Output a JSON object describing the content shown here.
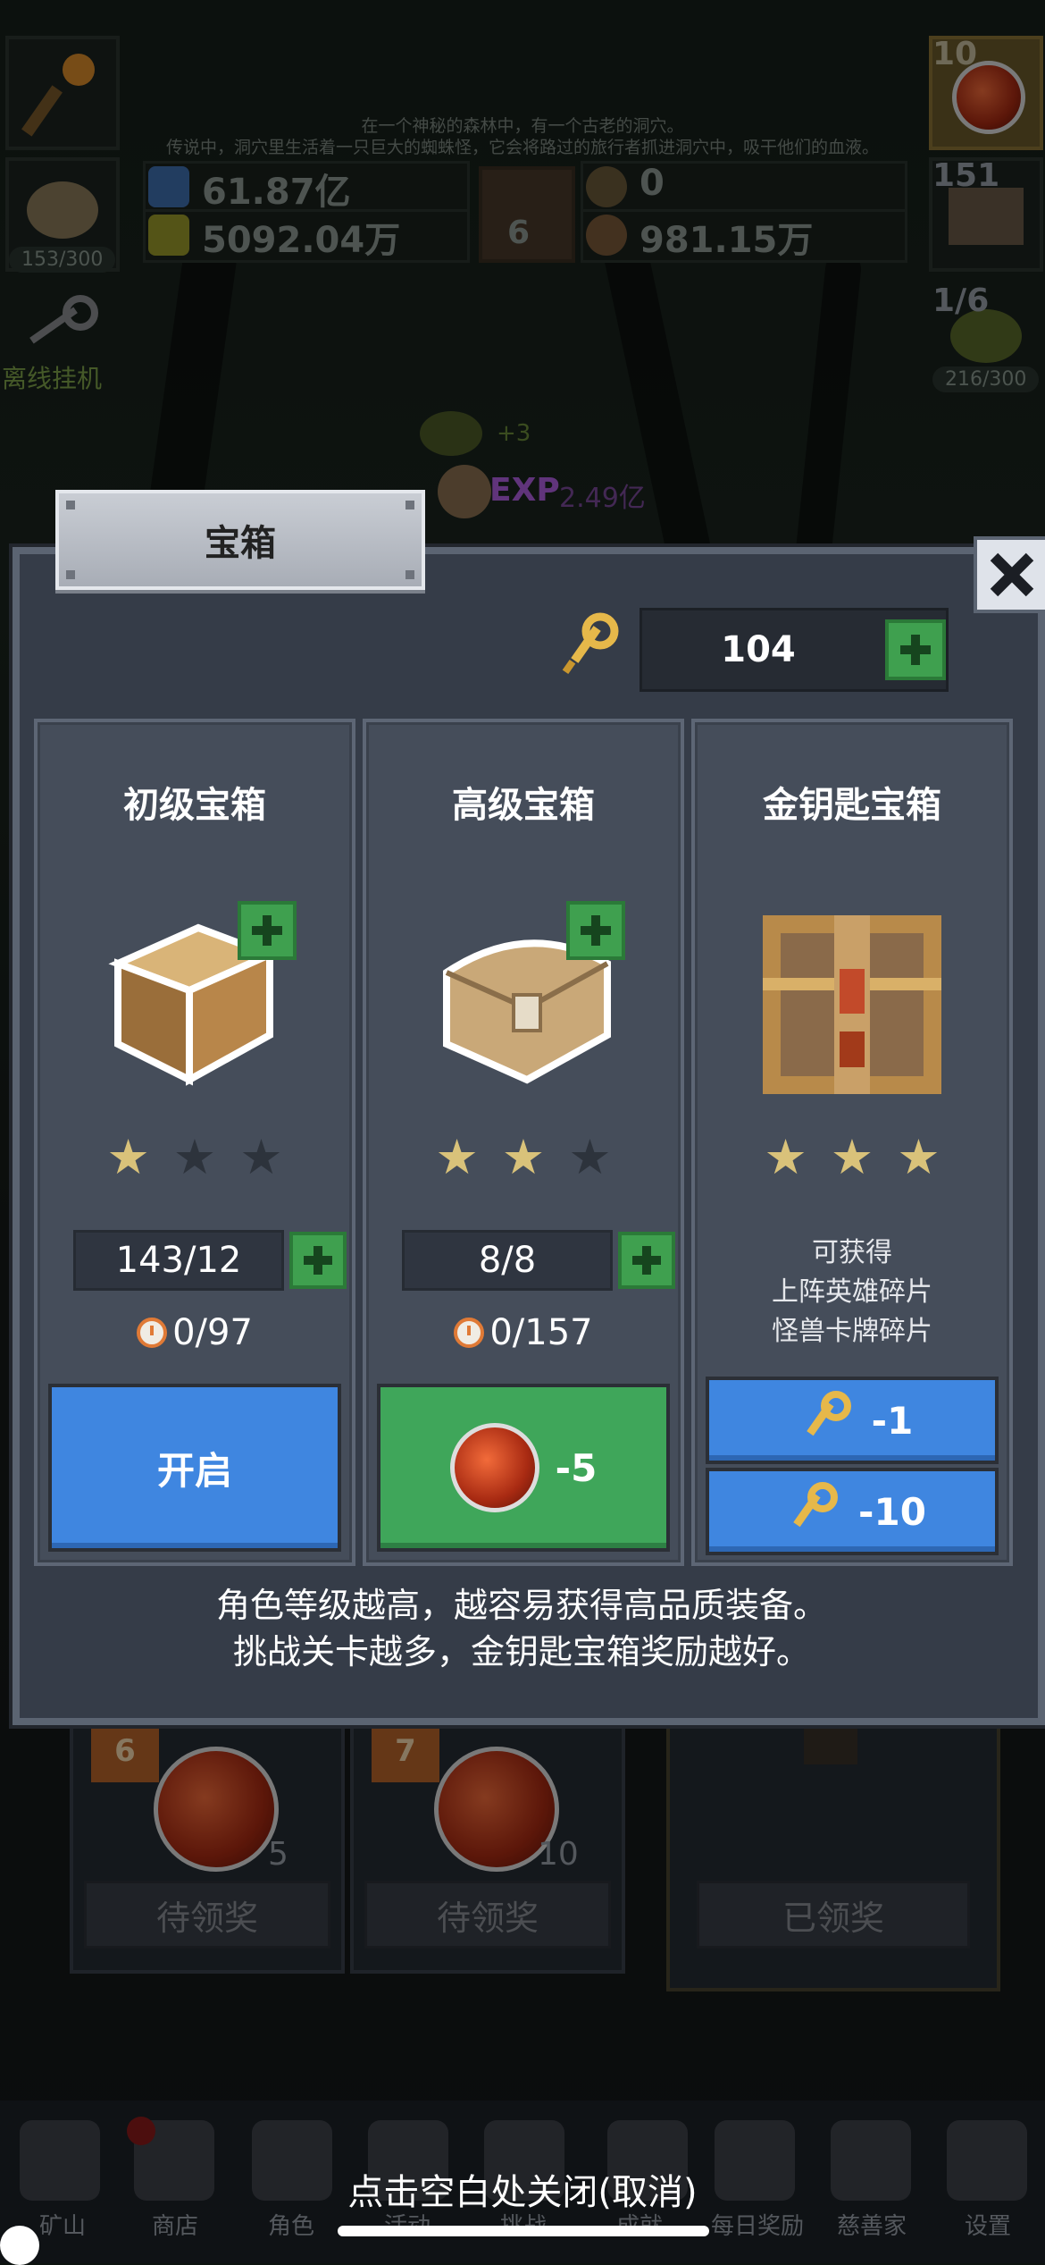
{
  "background": {
    "story_line1": "在一个神秘的森林中，有一个古老的洞穴。",
    "story_line2": "传说中，洞穴里生活着一只巨大的蜘蛛怪，它会将路过的旅行者抓进洞穴中，吸干他们的血液。",
    "resources": [
      {
        "value": "61.87亿"
      },
      {
        "value": "5092.04万"
      },
      {
        "value": "0"
      },
      {
        "value": "981.15万"
      }
    ],
    "book_count": "6",
    "left_slots": {
      "slot2_label": "153/300",
      "offline_label": "离线挂机"
    },
    "right_slots": {
      "potion_count": "10",
      "chest_count": "151",
      "slime_count": "1/6",
      "slime_label": "216/300"
    },
    "float_exp": "EXP",
    "float_plus": "+3",
    "float_value": "2.49亿"
  },
  "modal": {
    "title": "宝箱",
    "key_count": "104",
    "columns": [
      {
        "title": "初级宝箱",
        "stars_on": 1,
        "count": "143/12",
        "timer": "0/97",
        "button_label": "开启"
      },
      {
        "title": "高级宝箱",
        "stars_on": 2,
        "count": "8/8",
        "timer": "0/157",
        "button_label": "-5"
      },
      {
        "title": "金钥匙宝箱",
        "stars_on": 3,
        "info_line1": "可获得",
        "info_line2": "上阵英雄碎片",
        "info_line3": "怪兽卡牌碎片",
        "button1_label": "-1",
        "button2_label": "-10"
      }
    ],
    "desc_line1": "角色等级越高，越容易获得高品质装备。",
    "desc_line2": "挑战关卡越多，金钥匙宝箱奖励越好。"
  },
  "rewards": [
    {
      "badge": "6",
      "amount": "5",
      "button": "待领奖"
    },
    {
      "badge": "7",
      "amount": "10",
      "button": "待领奖"
    },
    {
      "button": "已领奖"
    }
  ],
  "nav": {
    "items": [
      "矿山",
      "商店",
      "角色",
      "活动",
      "挑战",
      "成就",
      "每日奖励",
      "慈善家",
      "设置"
    ],
    "close_hint": "点击空白处关闭(取消)"
  },
  "colors": {
    "accent_blue": "#3f86e0",
    "accent_green": "#3fa65a",
    "star_gold": "#d9c27a"
  }
}
